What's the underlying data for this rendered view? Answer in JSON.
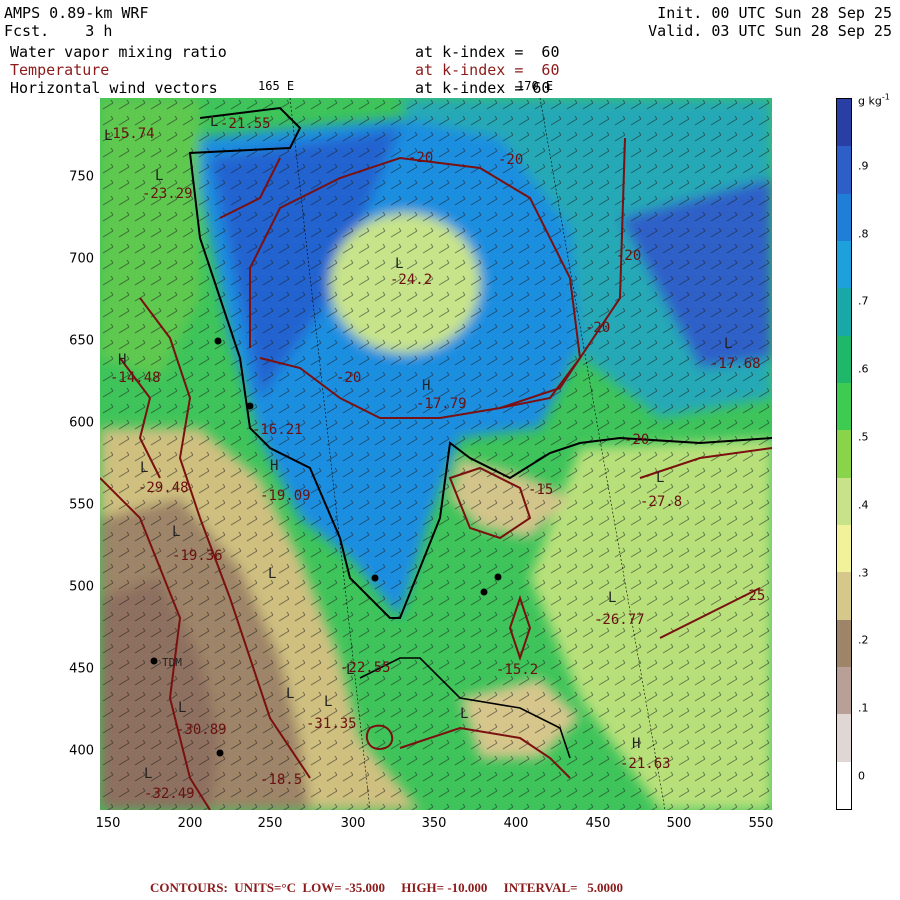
{
  "header": {
    "model": "AMPS 0.89-km WRF",
    "fcst": "Fcst.    3 h",
    "init": "Init. 00 UTC Sun 28 Sep 25",
    "valid": "Valid. 03 UTC Sun 28 Sep 25",
    "fields": [
      {
        "name": "Water vapor mixing ratio",
        "level": "at k-index =  60",
        "color": "#000000"
      },
      {
        "name": "Temperature",
        "level": "at k-index =  60",
        "color": "#8b1a1a"
      },
      {
        "name": "Horizontal wind vectors",
        "level": "at k-index = 60",
        "color": "#000000"
      }
    ],
    "lon_labels": [
      "165 E",
      "170 E"
    ]
  },
  "axes": {
    "x_ticks": [
      "150",
      "200",
      "250",
      "300",
      "350",
      "400",
      "450",
      "500",
      "550"
    ],
    "y_ticks": [
      "750",
      "700",
      "650",
      "600",
      "550",
      "500",
      "450",
      "400"
    ]
  },
  "colorbar": {
    "units": "g kg",
    "units_sup": "-1",
    "labels": [
      ".9",
      ".8",
      ".7",
      ".6",
      ".5",
      ".4",
      ".3",
      ".2",
      ".1",
      "0"
    ],
    "colors": [
      "#2a3fa6",
      "#2d5fc8",
      "#1f7fd8",
      "#1ea0dc",
      "#18a8a8",
      "#1fb86a",
      "#3ecb52",
      "#8ad44c",
      "#c8e28a",
      "#f2f29a",
      "#d6c88a",
      "#9e8468",
      "#b8a098",
      "#e0d6d4",
      "#ffffff"
    ]
  },
  "map_labels": {
    "contour_values": [
      "-20",
      "-20",
      "-20",
      "-20",
      "-20",
      "-20",
      "-25",
      "-15"
    ],
    "extrema": [
      {
        "mark": "L",
        "value": "-24.2"
      },
      {
        "mark": "L",
        "value": "-21.55"
      },
      {
        "mark": "L",
        "value": "-23.29"
      },
      {
        "mark": "H",
        "value": "-17.79"
      },
      {
        "mark": "H",
        "value": "-14.48"
      },
      {
        "mark": "L",
        "value": "-17.68"
      },
      {
        "mark": "H",
        "value": "-16.21"
      },
      {
        "mark": "L",
        "value": "-27.8"
      },
      {
        "mark": "L",
        "value": "-26.77"
      },
      {
        "mark": "H",
        "value": "-21.63"
      },
      {
        "mark": "L",
        "value": "-29.48"
      },
      {
        "mark": "L",
        "value": "-19.36"
      },
      {
        "mark": "L",
        "value": "-19.09"
      },
      {
        "mark": "L",
        "value": "-22.55"
      },
      {
        "mark": "L",
        "value": "-31.35"
      },
      {
        "mark": "L",
        "value": "-30.89"
      },
      {
        "mark": "L",
        "value": "-32.49"
      },
      {
        "mark": "L",
        "value": "-15.74"
      },
      {
        "mark": "L",
        "value": "-15.2"
      },
      {
        "mark": "L",
        "value": "-18.5"
      }
    ],
    "station": "TDM"
  },
  "footer": "CONTOURS:  UNITS=°C  LOW= -35.000     HIGH= -10.000     INTERVAL=   5.0000"
}
